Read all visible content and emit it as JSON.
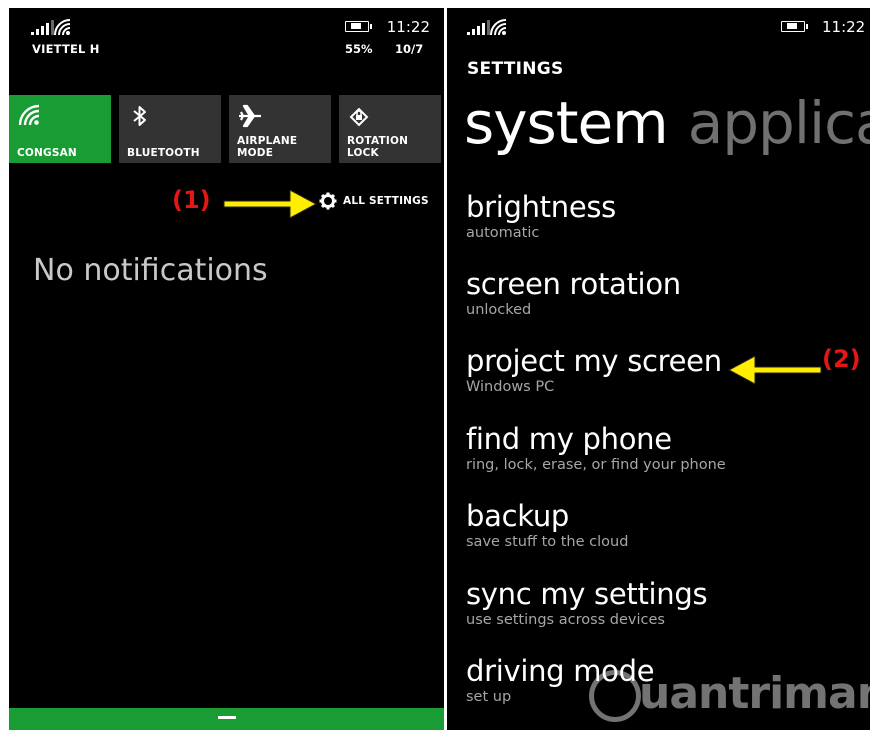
{
  "left_screen": {
    "status": {
      "carrier": "VIETTEL H",
      "time": "11:22",
      "battery_percent": "55%",
      "date": "10/7",
      "signal_icon": "signal-bars-icon",
      "wifi_icon": "wifi-icon",
      "battery_icon": "battery-charging-icon"
    },
    "quick_actions": [
      {
        "label": "CONGSAN",
        "icon": "wifi-icon",
        "active": true
      },
      {
        "label": "BLUETOOTH",
        "icon": "bluetooth-icon",
        "active": false
      },
      {
        "label": "AIRPLANE MODE",
        "icon": "airplane-icon",
        "active": false
      },
      {
        "label": "ROTATION LOCK",
        "icon": "rotation-lock-icon",
        "active": false
      }
    ],
    "all_settings": {
      "label": "ALL SETTINGS",
      "icon": "gear-icon"
    },
    "annotation": "(1)",
    "notifications_text": "No notifications",
    "accent": "#1a9c34"
  },
  "right_screen": {
    "status": {
      "time": "11:22"
    },
    "header": "SETTINGS",
    "pivot": {
      "active": "system",
      "next": "applica"
    },
    "items": [
      {
        "title": "brightness",
        "subtitle": "automatic"
      },
      {
        "title": "screen rotation",
        "subtitle": "unlocked"
      },
      {
        "title": "project my screen",
        "subtitle": "Windows PC"
      },
      {
        "title": "find my phone",
        "subtitle": "ring, lock, erase, or find your phone"
      },
      {
        "title": "backup",
        "subtitle": "save stuff to the cloud"
      },
      {
        "title": "sync my settings",
        "subtitle": "use settings across devices"
      },
      {
        "title": "driving mode",
        "subtitle": "set up"
      }
    ],
    "annotation": "(2)",
    "watermark": "uantrimang"
  },
  "colors": {
    "annotation_red": "#e51616",
    "arrow_yellow": "#ffee00"
  }
}
